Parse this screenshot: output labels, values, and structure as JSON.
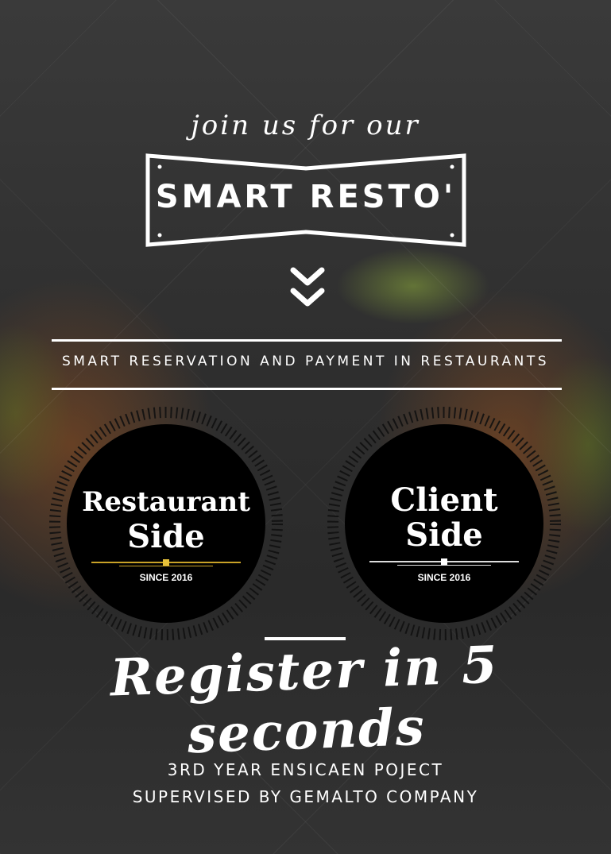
{
  "intro": "join us for our",
  "title": "SMART RESTO'",
  "tagline": "SMART RESERVATION AND PAYMENT IN RESTAURANTS",
  "badges": [
    {
      "line1": "Restaurant",
      "line2": "Side",
      "since": "SINCE 2016",
      "accent": "#e8c23a"
    },
    {
      "line1": "Client",
      "line2": "Side",
      "since": "SINCE 2016",
      "accent": "#ffffff"
    }
  ],
  "cta": "Register in 5 seconds",
  "footer": {
    "line1": "3RD YEAR ENSICAEN POJECT",
    "line2": "SUPERVISED BY GEMALTO COMPANY"
  },
  "colors": {
    "text": "#ffffff",
    "disc": "#000000"
  }
}
